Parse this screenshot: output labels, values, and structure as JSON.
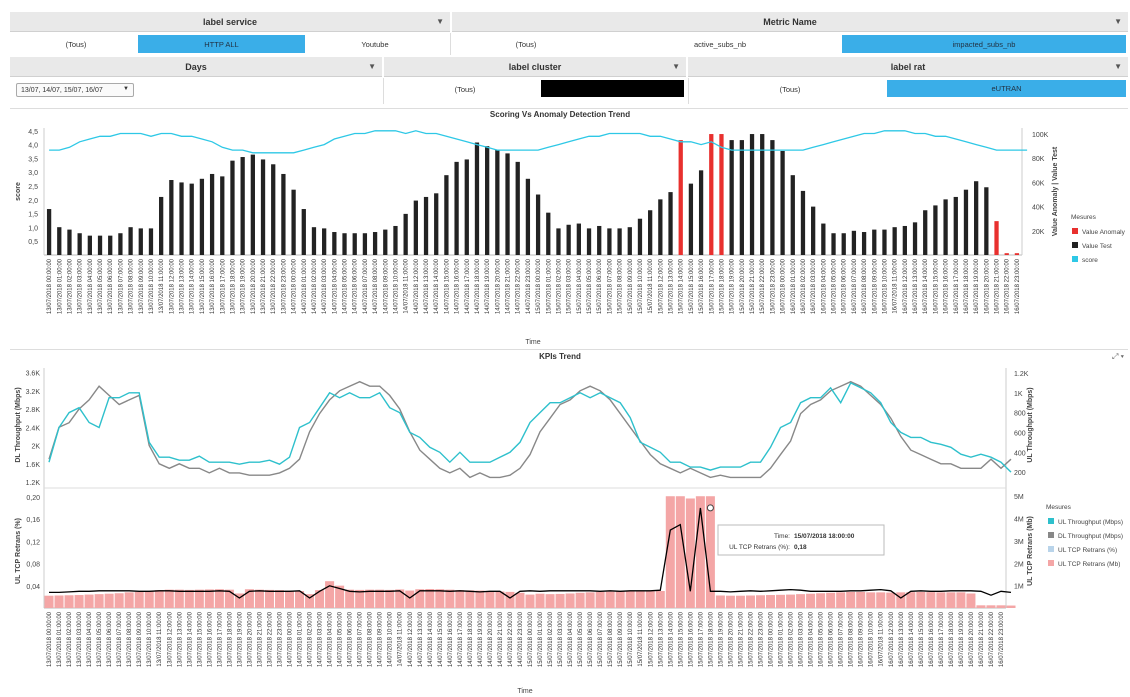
{
  "filters": {
    "label_service": {
      "header": "label service",
      "options": [
        "(Tous)",
        "HTTP ALL",
        "Youtube"
      ],
      "selected": "HTTP ALL"
    },
    "metric_name": {
      "header": "Metric Name",
      "options": [
        "(Tous)",
        "active_subs_nb",
        "impacted_subs_nb"
      ],
      "selected": "impacted_subs_nb"
    },
    "days": {
      "header": "Days",
      "value": "13/07, 14/07, 15/07, 16/07"
    },
    "label_cluster": {
      "header": "label cluster",
      "options": [
        "(Tous)"
      ]
    },
    "label_rat": {
      "header": "label rat",
      "options": [
        "(Tous)",
        "eUTRAN"
      ],
      "selected": "eUTRAN"
    }
  },
  "colors": {
    "accent": "#3aaee8",
    "anomaly": "#e8302e",
    "value_test": "#222222",
    "score": "#2ec8e6",
    "ul_thr": "#2ec0cc",
    "dl_thr": "#888888",
    "ul_tcp": "#f4a6a6",
    "ul_tcp_line": "#000000"
  },
  "icons": {
    "dropdown": "caret-down-icon",
    "expand": "expand-icon"
  },
  "chart1": {
    "title": "Scoring Vs Anomaly Detection Trend",
    "ylabel": "score",
    "y2label": "Value Anomaly  |  Value Test",
    "xlabel": "Time",
    "yticks": [
      "4,5",
      "4,0",
      "3,5",
      "3,0",
      "2,5",
      "2,0",
      "1,5",
      "1,0",
      "0,5"
    ],
    "y2ticks": [
      "100K",
      "80K",
      "60K",
      "40K",
      "20K"
    ],
    "legend_title": "Mesures",
    "legend": [
      "Value Anomaly",
      "Value Test",
      "score"
    ]
  },
  "chart2": {
    "title": "KPIs Trend",
    "top_ylabel": "DL Throughput (Mbps)",
    "top_y2label": "UL Throughput (Mbps)",
    "top_yticks": [
      "3.6K",
      "3.2K",
      "2.8K",
      "2.4K",
      "2K",
      "1.6K",
      "1.2K"
    ],
    "top_y2ticks": [
      "1.2K",
      "1K",
      "800",
      "600",
      "400",
      "200"
    ],
    "bot_ylabel": "UL TCP Retrans (%)",
    "bot_y2label": "UL TCP Retrans (Mb)",
    "bot_yticks": [
      "0,20",
      "0,16",
      "0,12",
      "0,08",
      "0,04"
    ],
    "bot_y2ticks": [
      "5M",
      "4M",
      "3M",
      "2M",
      "1M"
    ],
    "xlabel": "Time",
    "legend_title": "Mesures",
    "legend": [
      "UL Throughput (Mbps)",
      "DL Throughput (Mbps)",
      "UL TCP Retrans (%)",
      "UL TCP Retrans (Mb)"
    ],
    "tooltip": {
      "time_label": "Time:",
      "time_value": "15/07/2018 18:00:00",
      "metric_label": "UL TCP Retrans (%):",
      "metric_value": "0,18"
    }
  },
  "chart_data": [
    {
      "type": "bar",
      "title": "Scoring Vs Anomaly Detection Trend",
      "x_start": "13/07/2018 00:00:00",
      "x_end": "16/07/2018 23:00:00",
      "x_step": "1 hour",
      "ylabel": "score",
      "ylim": [
        0,
        4.6
      ],
      "y2label": "Value Anomaly | Value Test",
      "y2lim": [
        0,
        105000
      ],
      "series": [
        {
          "name": "Value Test",
          "values": [
            38000,
            23000,
            21000,
            18000,
            16000,
            16000,
            16000,
            18000,
            23000,
            22000,
            22000,
            48000,
            62000,
            60000,
            59000,
            63000,
            67000,
            65000,
            78000,
            81000,
            83000,
            79000,
            75000,
            67000,
            54000,
            38000,
            23000,
            22000,
            19000,
            18000,
            18000,
            18000,
            19000,
            21000,
            24000,
            34000,
            45000,
            48000,
            51000,
            66000,
            77000,
            79000,
            93000,
            90000,
            87000,
            84000,
            77000,
            63000,
            50000,
            35000,
            22000,
            25000,
            26000,
            22000,
            24000,
            22000,
            22000,
            23000,
            30000,
            37000,
            46000,
            52000,
            54000,
            59000,
            70000,
            94000,
            95000,
            95000,
            95000,
            100000,
            100000,
            95000,
            86000,
            66000,
            53000,
            40000,
            26000,
            18000,
            18000,
            20000,
            19000,
            21000,
            21000,
            23000,
            24000,
            27000,
            37000,
            41000,
            46000,
            48000,
            54000,
            61000,
            56000,
            67000,
            69000,
            74000,
            69000
          ]
        },
        {
          "name": "Value Anomaly",
          "values": {
            "15/07 14:00": 95000,
            "15/07 17:00": 100000,
            "15/07 18:00": 100000,
            "16/07 21:00": 28000,
            "16/07 22:00": 1500,
            "16/07 23:00": 1500
          }
        },
        {
          "name": "score",
          "values": [
            3.8,
            3.8,
            3.9,
            4.1,
            4.2,
            4.3,
            4.3,
            4.4,
            4.4,
            4.4,
            4.3,
            4.4,
            4.4,
            4.3,
            4.3,
            4.2,
            4.1,
            3.9,
            3.8,
            3.8,
            3.7,
            3.7,
            3.7,
            3.7,
            3.7,
            3.8,
            3.9,
            4.0,
            4.2,
            4.3,
            4.4,
            4.4,
            4.5,
            4.5,
            4.5,
            4.4,
            4.5,
            4.4,
            4.4,
            4.3,
            4.2,
            4.1,
            4.0,
            3.9,
            3.8,
            3.8,
            3.8,
            3.8,
            3.8,
            3.9,
            4.0,
            4.1,
            4.2,
            4.3,
            4.3,
            4.4,
            4.4,
            4.4,
            4.4,
            4.3,
            4.3,
            4.2,
            4.1,
            4.1,
            4.0,
            4.1,
            3.9,
            3.8,
            3.8,
            3.8,
            3.8,
            3.8,
            3.8,
            3.8,
            3.8,
            3.9,
            4.0,
            4.1,
            4.2,
            4.3,
            4.4,
            4.4,
            4.5,
            4.5,
            4.5,
            4.4,
            4.4,
            4.3,
            4.3,
            4.2,
            4.1,
            4.0,
            3.9,
            3.8,
            3.8,
            3.8,
            3.8
          ]
        }
      ]
    },
    {
      "type": "line",
      "title": "KPIs Trend",
      "ylabel": "DL Throughput (Mbps)",
      "ylim": [
        1200,
        3700
      ],
      "y2label": "UL Throughput (Mbps)",
      "y2lim": [
        100,
        1250
      ],
      "series": [
        {
          "name": "DL Throughput (Mbps)",
          "values": [
            1700,
            2400,
            2500,
            2800,
            3000,
            3300,
            3100,
            2900,
            3000,
            3100,
            2000,
            1600,
            1500,
            1600,
            1500,
            1500,
            1400,
            1500,
            1400,
            1400,
            1350,
            1350,
            1350,
            1400,
            1500,
            1700,
            2300,
            2700,
            3000,
            3200,
            3300,
            3400,
            3300,
            3300,
            3100,
            2800,
            2300,
            1900,
            1700,
            1500,
            1400,
            1500,
            1300,
            1400,
            1300,
            1300,
            1350,
            1500,
            1800,
            2300,
            2600,
            2900,
            3000,
            3200,
            3300,
            3200,
            3000,
            2700,
            2400,
            2100,
            1800,
            1600,
            1500,
            1400,
            1500,
            1400,
            1300,
            1350,
            1300,
            1300,
            1300,
            1300,
            1500,
            1800,
            2100,
            2700,
            2900,
            3000,
            3200,
            3300,
            3400,
            3300,
            3100,
            2900,
            2600,
            2200,
            1900,
            1800,
            1700,
            1600,
            1600,
            1500,
            1500,
            1500,
            1700,
            1500,
            1700
          ]
        },
        {
          "name": "UL Throughput (Mbps)",
          "values": [
            300,
            650,
            800,
            850,
            700,
            650,
            950,
            950,
            1000,
            1000,
            500,
            350,
            350,
            320,
            320,
            360,
            300,
            300,
            300,
            280,
            300,
            300,
            320,
            280,
            350,
            650,
            700,
            850,
            1000,
            950,
            1000,
            950,
            950,
            1000,
            850,
            800,
            600,
            550,
            450,
            400,
            300,
            400,
            300,
            300,
            300,
            350,
            400,
            500,
            700,
            800,
            900,
            900,
            950,
            1000,
            950,
            1000,
            950,
            900,
            750,
            500,
            450,
            400,
            300,
            300,
            250,
            250,
            220,
            250,
            250,
            250,
            300,
            300,
            450,
            650,
            700,
            900,
            950,
            950,
            1050,
            900,
            1100,
            1050,
            1000,
            900,
            700,
            600,
            550,
            550,
            500,
            480,
            450,
            380,
            350,
            380,
            350,
            300,
            200
          ]
        },
        {
          "name": "UL TCP Retrans (%)",
          "values": [
            0.028,
            0.028,
            0.029,
            0.03,
            0.03,
            0.031,
            0.031,
            0.031,
            0.031,
            0.03,
            0.03,
            0.031,
            0.031,
            0.03,
            0.03,
            0.03,
            0.03,
            0.031,
            0.03,
            0.018,
            0.03,
            0.031,
            0.03,
            0.03,
            0.03,
            0.031,
            0.018,
            0.03,
            0.04,
            0.035,
            0.03,
            0.029,
            0.03,
            0.03,
            0.03,
            0.031,
            0.018,
            0.031,
            0.031,
            0.031,
            0.03,
            0.031,
            0.03,
            0.029,
            0.03,
            0.03,
            0.018,
            0.03,
            0.031,
            0.03,
            0.031,
            0.031,
            0.031,
            0.031,
            0.031,
            0.03,
            0.031,
            0.03,
            0.031,
            0.031,
            0.031,
            0.032,
            0.14,
            0.15,
            0.03,
            0.18,
            0.03,
            0.03,
            0.029,
            0.03,
            0.031,
            0.03,
            0.031,
            0.032,
            0.033,
            0.032,
            0.03,
            0.03,
            0.03,
            0.03,
            0.031,
            0.031,
            0.032,
            0.033,
            0.031,
            0.018,
            0.03,
            0.031,
            0.03,
            0.03,
            0.031,
            0.031,
            0.031,
            0.03,
            0.023,
            0.03,
            0.028
          ]
        },
        {
          "name": "UL TCP Retrans (Mb)",
          "values": [
            550000,
            560000,
            570000,
            580000,
            600000,
            620000,
            640000,
            660000,
            700000,
            720000,
            760000,
            800000,
            820000,
            820000,
            810000,
            820000,
            830000,
            840000,
            820000,
            650000,
            840000,
            820000,
            810000,
            800000,
            780000,
            760000,
            620000,
            800000,
            1200000,
            1000000,
            820000,
            810000,
            820000,
            820000,
            810000,
            830000,
            780000,
            840000,
            850000,
            840000,
            820000,
            800000,
            790000,
            780000,
            760000,
            740000,
            720000,
            680000,
            600000,
            640000,
            620000,
            630000,
            650000,
            680000,
            700000,
            720000,
            730000,
            750000,
            760000,
            760000,
            750000,
            760000,
            5000000,
            5000000,
            4900000,
            5000000,
            5000000,
            560000,
            550000,
            550000,
            560000,
            570000,
            580000,
            590000,
            600000,
            620000,
            640000,
            660000,
            680000,
            700000,
            720000,
            720000,
            700000,
            700000,
            690000,
            700000,
            710000,
            720000,
            710000,
            700000,
            700000,
            700000,
            650000,
            120000,
            120000,
            120000,
            110000
          ]
        }
      ]
    }
  ]
}
